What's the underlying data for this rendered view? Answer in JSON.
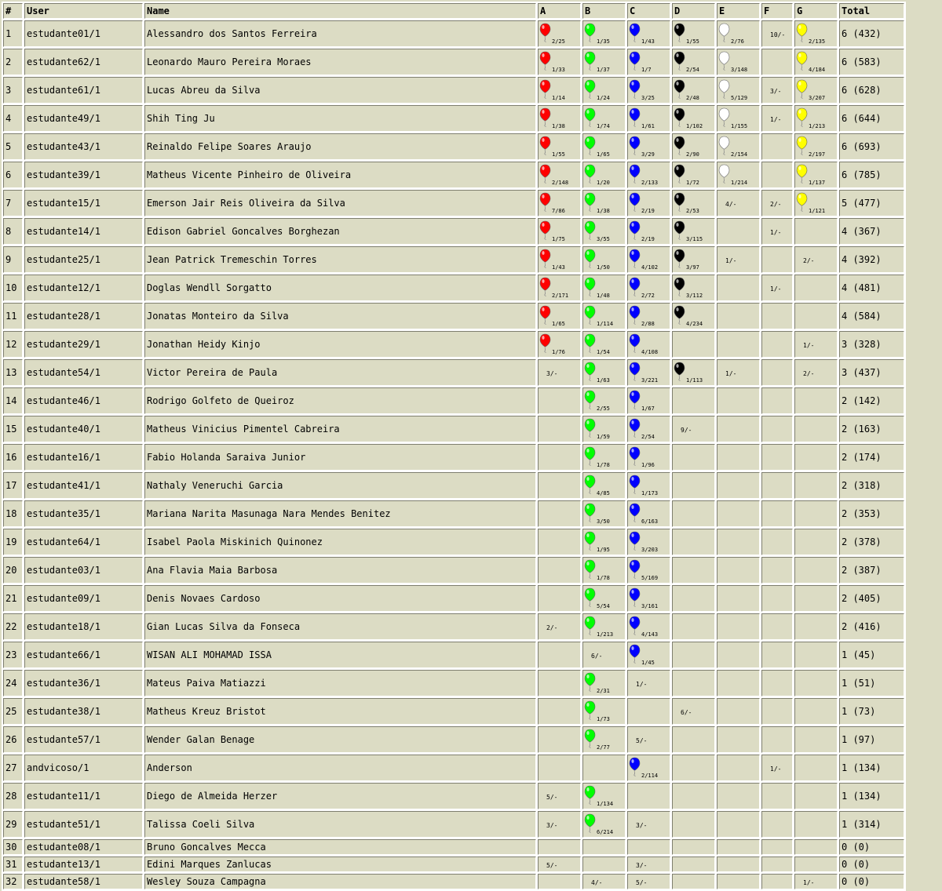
{
  "headers": {
    "rank": "#",
    "user": "User",
    "name": "Name",
    "total": "Total"
  },
  "problems": [
    {
      "letter": "A",
      "color": "#ff0000"
    },
    {
      "letter": "B",
      "color": "#00ff00"
    },
    {
      "letter": "C",
      "color": "#0000ff"
    },
    {
      "letter": "D",
      "color": "#000000"
    },
    {
      "letter": "E",
      "color": "#ffffff"
    },
    {
      "letter": "F",
      "color": "#ff8800"
    },
    {
      "letter": "G",
      "color": "#ffff00"
    }
  ],
  "rows": [
    {
      "rank": "1",
      "user": "estudante01/1",
      "name": "Alessandro dos Santos Ferreira",
      "cells": [
        {
          "solved": true,
          "text": "2/25"
        },
        {
          "solved": true,
          "text": "1/35"
        },
        {
          "solved": true,
          "text": "1/43"
        },
        {
          "solved": true,
          "text": "1/55"
        },
        {
          "solved": true,
          "text": "2/76"
        },
        {
          "solved": false,
          "text": "10/-"
        },
        {
          "solved": true,
          "text": "2/135"
        }
      ],
      "total": "6 (432)"
    },
    {
      "rank": "2",
      "user": "estudante62/1",
      "name": "Leonardo Mauro Pereira Moraes",
      "cells": [
        {
          "solved": true,
          "text": "1/33"
        },
        {
          "solved": true,
          "text": "1/37"
        },
        {
          "solved": true,
          "text": "1/7"
        },
        {
          "solved": true,
          "text": "2/54"
        },
        {
          "solved": true,
          "text": "3/148"
        },
        null,
        {
          "solved": true,
          "text": "4/184"
        }
      ],
      "total": "6 (583)"
    },
    {
      "rank": "3",
      "user": "estudante61/1",
      "name": "Lucas Abreu da Silva",
      "cells": [
        {
          "solved": true,
          "text": "1/14"
        },
        {
          "solved": true,
          "text": "1/24"
        },
        {
          "solved": true,
          "text": "3/25"
        },
        {
          "solved": true,
          "text": "2/48"
        },
        {
          "solved": true,
          "text": "5/129"
        },
        {
          "solved": false,
          "text": "3/-"
        },
        {
          "solved": true,
          "text": "3/207"
        }
      ],
      "total": "6 (628)"
    },
    {
      "rank": "4",
      "user": "estudante49/1",
      "name": "Shih Ting Ju",
      "cells": [
        {
          "solved": true,
          "text": "1/38"
        },
        {
          "solved": true,
          "text": "1/74"
        },
        {
          "solved": true,
          "text": "1/61"
        },
        {
          "solved": true,
          "text": "1/102"
        },
        {
          "solved": true,
          "text": "1/155"
        },
        {
          "solved": false,
          "text": "1/-"
        },
        {
          "solved": true,
          "text": "1/213"
        }
      ],
      "total": "6 (644)"
    },
    {
      "rank": "5",
      "user": "estudante43/1",
      "name": "Reinaldo Felipe Soares Araujo",
      "cells": [
        {
          "solved": true,
          "text": "1/55"
        },
        {
          "solved": true,
          "text": "1/65"
        },
        {
          "solved": true,
          "text": "3/29"
        },
        {
          "solved": true,
          "text": "2/90"
        },
        {
          "solved": true,
          "text": "2/154"
        },
        null,
        {
          "solved": true,
          "text": "2/197"
        }
      ],
      "total": "6 (693)"
    },
    {
      "rank": "6",
      "user": "estudante39/1",
      "name": "Matheus Vicente Pinheiro de Oliveira",
      "cells": [
        {
          "solved": true,
          "text": "2/148"
        },
        {
          "solved": true,
          "text": "1/20"
        },
        {
          "solved": true,
          "text": "2/133"
        },
        {
          "solved": true,
          "text": "1/72"
        },
        {
          "solved": true,
          "text": "1/214"
        },
        null,
        {
          "solved": true,
          "text": "1/137"
        }
      ],
      "total": "6 (785)"
    },
    {
      "rank": "7",
      "user": "estudante15/1",
      "name": "Emerson Jair Reis Oliveira da Silva",
      "cells": [
        {
          "solved": true,
          "text": "7/86"
        },
        {
          "solved": true,
          "text": "1/38"
        },
        {
          "solved": true,
          "text": "2/19"
        },
        {
          "solved": true,
          "text": "2/53"
        },
        {
          "solved": false,
          "text": "4/-"
        },
        {
          "solved": false,
          "text": "2/-"
        },
        {
          "solved": true,
          "text": "1/121"
        }
      ],
      "total": "5 (477)"
    },
    {
      "rank": "8",
      "user": "estudante14/1",
      "name": "Edison Gabriel Goncalves Borghezan",
      "cells": [
        {
          "solved": true,
          "text": "1/75"
        },
        {
          "solved": true,
          "text": "3/55"
        },
        {
          "solved": true,
          "text": "2/19"
        },
        {
          "solved": true,
          "text": "3/115"
        },
        null,
        {
          "solved": false,
          "text": "1/-"
        },
        null
      ],
      "total": "4 (367)"
    },
    {
      "rank": "9",
      "user": "estudante25/1",
      "name": "Jean Patrick Tremeschin Torres",
      "cells": [
        {
          "solved": true,
          "text": "1/43"
        },
        {
          "solved": true,
          "text": "1/50"
        },
        {
          "solved": true,
          "text": "4/102"
        },
        {
          "solved": true,
          "text": "3/97"
        },
        {
          "solved": false,
          "text": "1/-"
        },
        null,
        {
          "solved": false,
          "text": "2/-"
        }
      ],
      "total": "4 (392)"
    },
    {
      "rank": "10",
      "user": "estudante12/1",
      "name": "Doglas Wendll Sorgatto",
      "cells": [
        {
          "solved": true,
          "text": "2/171"
        },
        {
          "solved": true,
          "text": "1/48"
        },
        {
          "solved": true,
          "text": "2/72"
        },
        {
          "solved": true,
          "text": "3/112"
        },
        null,
        {
          "solved": false,
          "text": "1/-"
        },
        null
      ],
      "total": "4 (481)"
    },
    {
      "rank": "11",
      "user": "estudante28/1",
      "name": "Jonatas Monteiro da Silva",
      "cells": [
        {
          "solved": true,
          "text": "1/65"
        },
        {
          "solved": true,
          "text": "1/114"
        },
        {
          "solved": true,
          "text": "2/88"
        },
        {
          "solved": true,
          "text": "4/234"
        },
        null,
        null,
        null
      ],
      "total": "4 (584)"
    },
    {
      "rank": "12",
      "user": "estudante29/1",
      "name": "Jonathan Heidy Kinjo",
      "cells": [
        {
          "solved": true,
          "text": "1/76"
        },
        {
          "solved": true,
          "text": "1/54"
        },
        {
          "solved": true,
          "text": "4/108"
        },
        null,
        null,
        null,
        {
          "solved": false,
          "text": "1/-"
        }
      ],
      "total": "3 (328)"
    },
    {
      "rank": "13",
      "user": "estudante54/1",
      "name": "Victor Pereira de Paula",
      "cells": [
        {
          "solved": false,
          "text": "3/-"
        },
        {
          "solved": true,
          "text": "1/63"
        },
        {
          "solved": true,
          "text": "3/221"
        },
        {
          "solved": true,
          "text": "1/113"
        },
        {
          "solved": false,
          "text": "1/-"
        },
        null,
        {
          "solved": false,
          "text": "2/-"
        }
      ],
      "total": "3 (437)"
    },
    {
      "rank": "14",
      "user": "estudante46/1",
      "name": "Rodrigo Golfeto de Queiroz",
      "cells": [
        null,
        {
          "solved": true,
          "text": "2/55"
        },
        {
          "solved": true,
          "text": "1/67"
        },
        null,
        null,
        null,
        null
      ],
      "total": "2 (142)"
    },
    {
      "rank": "15",
      "user": "estudante40/1",
      "name": "Matheus Vinicius Pimentel Cabreira",
      "cells": [
        null,
        {
          "solved": true,
          "text": "1/59"
        },
        {
          "solved": true,
          "text": "2/54"
        },
        {
          "solved": false,
          "text": "9/-"
        },
        null,
        null,
        null
      ],
      "total": "2 (163)"
    },
    {
      "rank": "16",
      "user": "estudante16/1",
      "name": "Fabio Holanda Saraiva Junior",
      "cells": [
        null,
        {
          "solved": true,
          "text": "1/78"
        },
        {
          "solved": true,
          "text": "1/96"
        },
        null,
        null,
        null,
        null
      ],
      "total": "2 (174)"
    },
    {
      "rank": "17",
      "user": "estudante41/1",
      "name": "Nathaly Veneruchi Garcia",
      "cells": [
        null,
        {
          "solved": true,
          "text": "4/85"
        },
        {
          "solved": true,
          "text": "1/173"
        },
        null,
        null,
        null,
        null
      ],
      "total": "2 (318)"
    },
    {
      "rank": "18",
      "user": "estudante35/1",
      "name": "Mariana Narita Masunaga Nara Mendes Benitez",
      "cells": [
        null,
        {
          "solved": true,
          "text": "3/50"
        },
        {
          "solved": true,
          "text": "6/163"
        },
        null,
        null,
        null,
        null
      ],
      "total": "2 (353)"
    },
    {
      "rank": "19",
      "user": "estudante64/1",
      "name": "Isabel Paola Miskinich Quinonez",
      "cells": [
        null,
        {
          "solved": true,
          "text": "1/95"
        },
        {
          "solved": true,
          "text": "3/203"
        },
        null,
        null,
        null,
        null
      ],
      "total": "2 (378)"
    },
    {
      "rank": "20",
      "user": "estudante03/1",
      "name": "Ana Flavia Maia Barbosa",
      "cells": [
        null,
        {
          "solved": true,
          "text": "1/78"
        },
        {
          "solved": true,
          "text": "5/169"
        },
        null,
        null,
        null,
        null
      ],
      "total": "2 (387)"
    },
    {
      "rank": "21",
      "user": "estudante09/1",
      "name": "Denis Novaes Cardoso",
      "cells": [
        null,
        {
          "solved": true,
          "text": "5/54"
        },
        {
          "solved": true,
          "text": "3/161"
        },
        null,
        null,
        null,
        null
      ],
      "total": "2 (405)"
    },
    {
      "rank": "22",
      "user": "estudante18/1",
      "name": "Gian Lucas Silva da Fonseca",
      "cells": [
        {
          "solved": false,
          "text": "2/-"
        },
        {
          "solved": true,
          "text": "1/213"
        },
        {
          "solved": true,
          "text": "4/143"
        },
        null,
        null,
        null,
        null
      ],
      "total": "2 (416)"
    },
    {
      "rank": "23",
      "user": "estudante66/1",
      "name": "WISAN ALI MOHAMAD ISSA",
      "cells": [
        null,
        {
          "solved": false,
          "text": "6/-"
        },
        {
          "solved": true,
          "text": "1/45"
        },
        null,
        null,
        null,
        null
      ],
      "total": "1 (45)"
    },
    {
      "rank": "24",
      "user": "estudante36/1",
      "name": "Mateus Paiva Matiazzi",
      "cells": [
        null,
        {
          "solved": true,
          "text": "2/31"
        },
        {
          "solved": false,
          "text": "1/-"
        },
        null,
        null,
        null,
        null
      ],
      "total": "1 (51)"
    },
    {
      "rank": "25",
      "user": "estudante38/1",
      "name": "Matheus Kreuz Bristot",
      "cells": [
        null,
        {
          "solved": true,
          "text": "1/73"
        },
        null,
        {
          "solved": false,
          "text": "6/-"
        },
        null,
        null,
        null
      ],
      "total": "1 (73)"
    },
    {
      "rank": "26",
      "user": "estudante57/1",
      "name": "Wender Galan Benage",
      "cells": [
        null,
        {
          "solved": true,
          "text": "2/77"
        },
        {
          "solved": false,
          "text": "5/-"
        },
        null,
        null,
        null,
        null
      ],
      "total": "1 (97)"
    },
    {
      "rank": "27",
      "user": "andvicoso/1",
      "name": "Anderson",
      "cells": [
        null,
        null,
        {
          "solved": true,
          "text": "2/114"
        },
        null,
        null,
        {
          "solved": false,
          "text": "1/-"
        },
        null
      ],
      "total": "1 (134)"
    },
    {
      "rank": "28",
      "user": "estudante11/1",
      "name": "Diego de Almeida Herzer",
      "cells": [
        {
          "solved": false,
          "text": "5/-"
        },
        {
          "solved": true,
          "text": "1/134"
        },
        null,
        null,
        null,
        null,
        null
      ],
      "total": "1 (134)"
    },
    {
      "rank": "29",
      "user": "estudante51/1",
      "name": "Talissa Coeli Silva",
      "cells": [
        {
          "solved": false,
          "text": "3/-"
        },
        {
          "solved": true,
          "text": "6/214"
        },
        {
          "solved": false,
          "text": "3/-"
        },
        null,
        null,
        null,
        null
      ],
      "total": "1 (314)"
    },
    {
      "rank": "30",
      "user": "estudante08/1",
      "name": "Bruno Goncalves Mecca",
      "cells": [
        null,
        null,
        null,
        null,
        null,
        null,
        null
      ],
      "total": "0 (0)"
    },
    {
      "rank": "31",
      "user": "estudante13/1",
      "name": "Edini Marques Zanlucas",
      "cells": [
        {
          "solved": false,
          "text": "5/-"
        },
        null,
        {
          "solved": false,
          "text": "3/-"
        },
        null,
        null,
        null,
        null
      ],
      "total": "0 (0)"
    },
    {
      "rank": "32",
      "user": "estudante58/1",
      "name": "Wesley Souza Campagna",
      "cells": [
        null,
        {
          "solved": false,
          "text": "4/-"
        },
        {
          "solved": false,
          "text": "5/-"
        },
        null,
        null,
        null,
        {
          "solved": false,
          "text": "1/-"
        }
      ],
      "total": "0 (0)"
    }
  ]
}
